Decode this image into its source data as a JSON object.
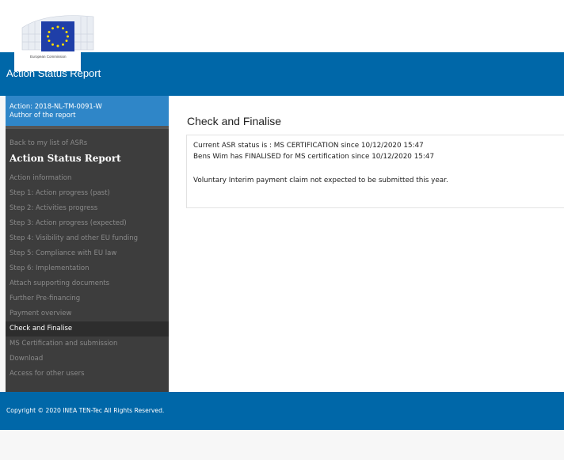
{
  "header": {
    "logo_text": "European Commission",
    "app_title": "Action Status Report"
  },
  "sidebar": {
    "action_line": "Action: 2018-NL-TM-0091-W",
    "author_line": "Author of the report",
    "back_link": "Back to my list of ASRs",
    "heading": "Action Status Report",
    "items": [
      {
        "label": "Action information",
        "active": false
      },
      {
        "label": "Step 1: Action progress (past)",
        "active": false
      },
      {
        "label": "Step 2: Activities progress",
        "active": false
      },
      {
        "label": "Step 3: Action progress (expected)",
        "active": false
      },
      {
        "label": "Step 4: Visibility and other EU funding",
        "active": false
      },
      {
        "label": "Step 5: Compliance with EU law",
        "active": false
      },
      {
        "label": "Step 6: Implementation",
        "active": false
      },
      {
        "label": "Attach supporting documents",
        "active": false
      },
      {
        "label": "Further Pre-financing",
        "active": false
      },
      {
        "label": "Payment overview",
        "active": false
      },
      {
        "label": "Check and Finalise",
        "active": true
      },
      {
        "label": "MS Certification and submission",
        "active": false
      },
      {
        "label": "Download",
        "active": false
      },
      {
        "label": "Access for other users",
        "active": false
      }
    ]
  },
  "main": {
    "title": "Check and Finalise",
    "status_line": "Current ASR status is : MS CERTIFICATION since 10/12/2020 15:47",
    "finalised_line": "Bens Wim has FINALISED for MS certification since 10/12/2020 15:47",
    "payment_line": "Voluntary Interim payment claim not expected to be submitted this year."
  },
  "footer": {
    "copyright": "Copyright © 2020 INEA TEN-Tec All Rights Reserved."
  },
  "colors": {
    "brand_blue": "#0067a8",
    "action_blue": "#2f86c8",
    "sidebar_bg": "#3d3d3d"
  }
}
